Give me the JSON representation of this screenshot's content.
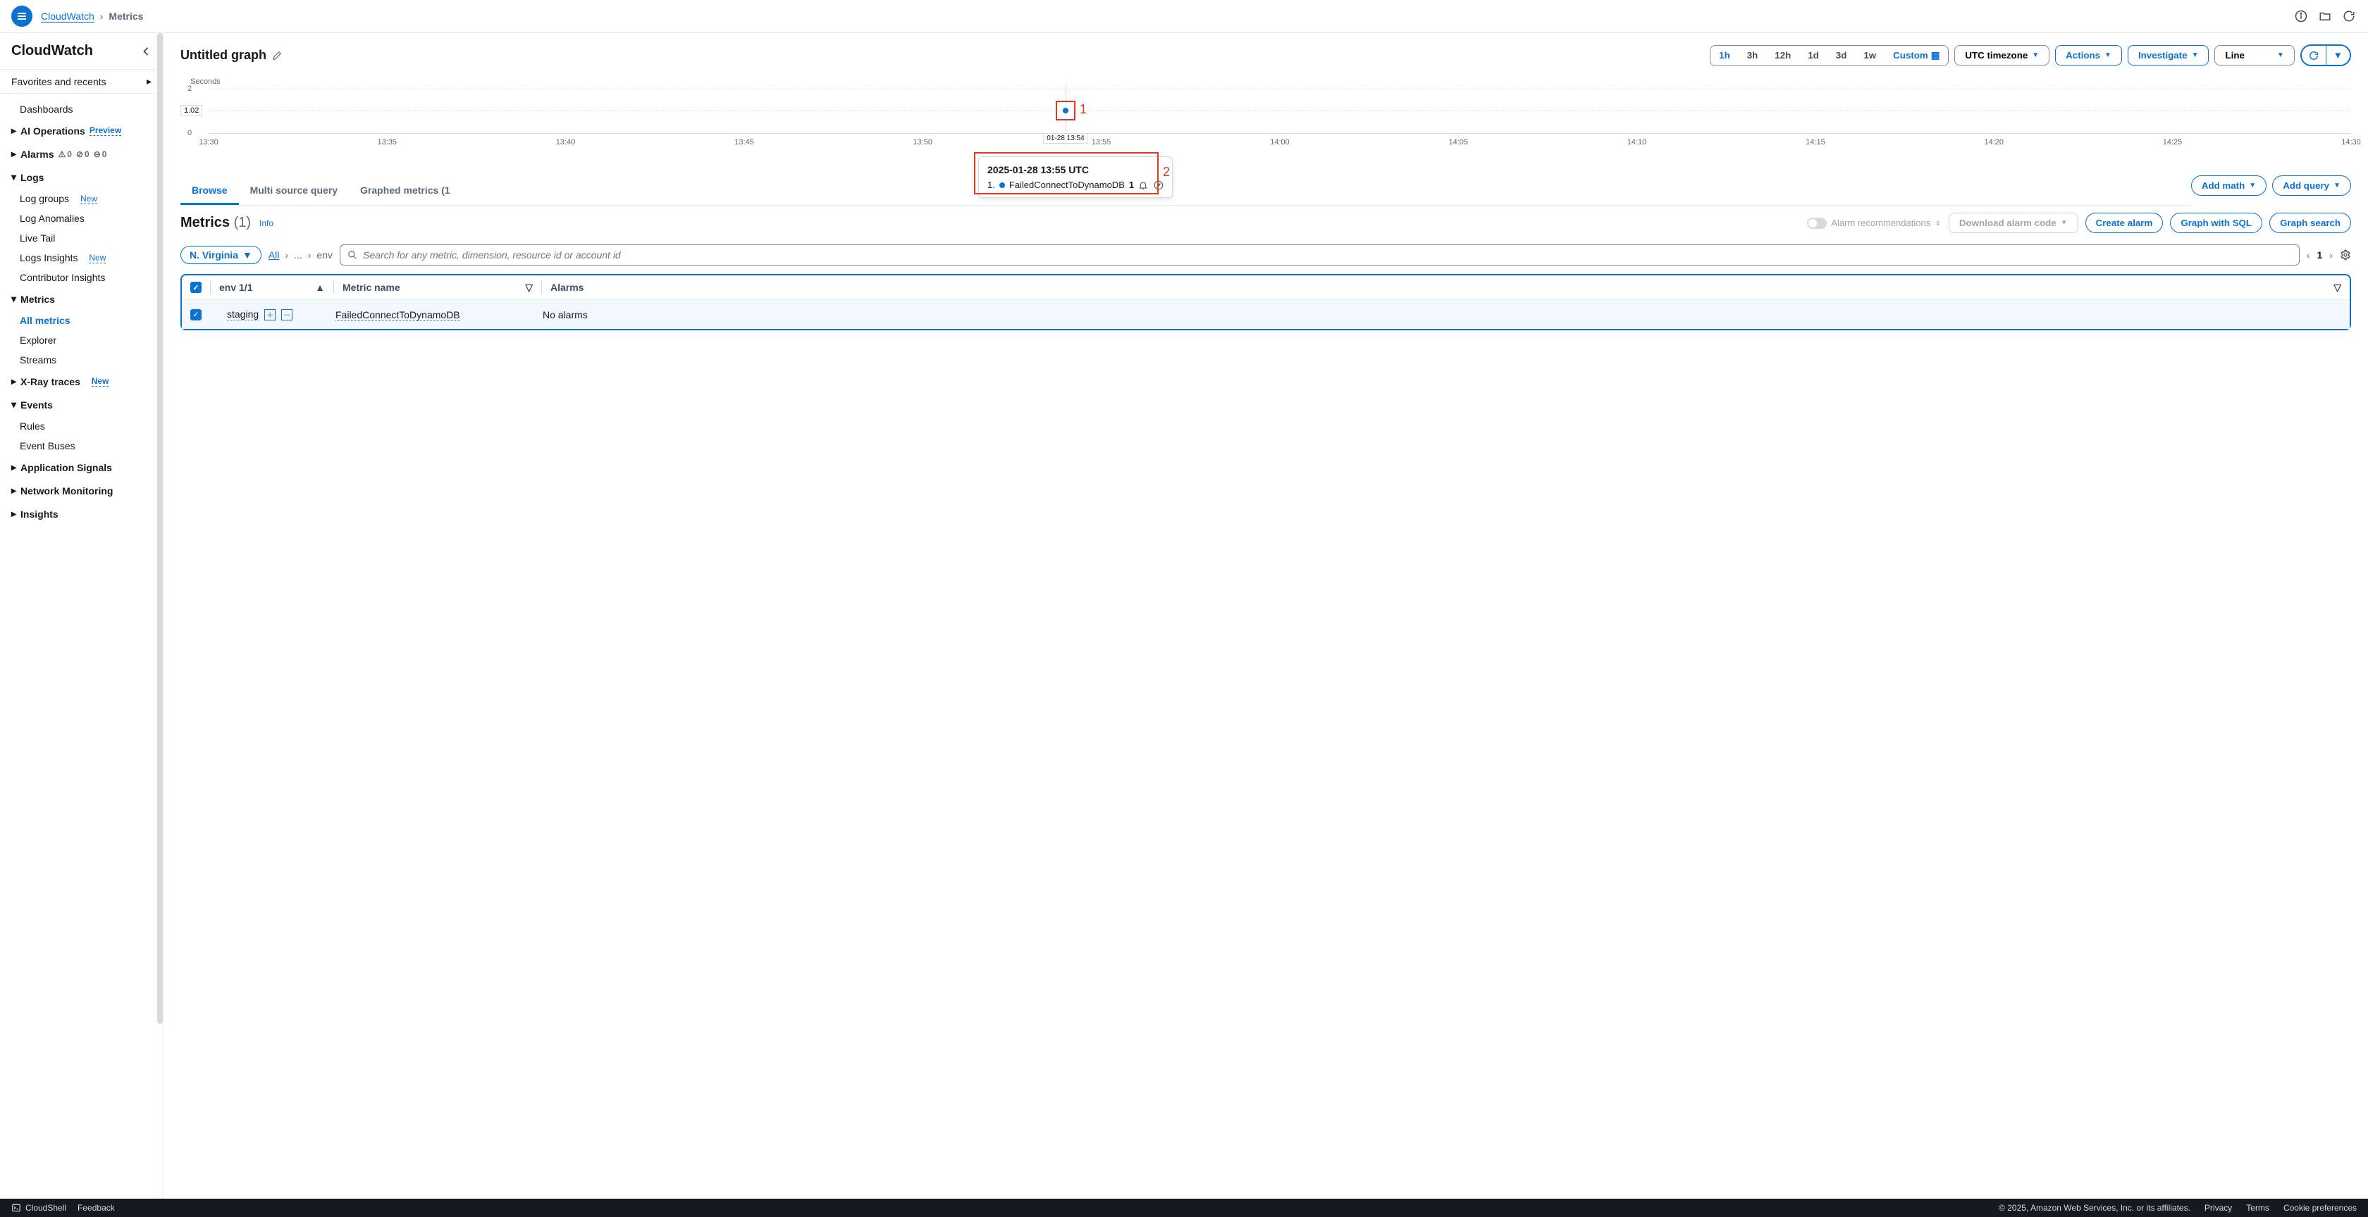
{
  "breadcrumb": {
    "root": "CloudWatch",
    "current": "Metrics"
  },
  "sidebar": {
    "title": "CloudWatch",
    "favorites": "Favorites and recents",
    "items": {
      "dashboards": "Dashboards",
      "aiops": "AI Operations",
      "aiops_badge": "Preview",
      "alarms": "Alarms",
      "logs": "Logs",
      "log_groups": "Log groups",
      "log_anomalies": "Log Anomalies",
      "live_tail": "Live Tail",
      "logs_insights": "Logs Insights",
      "contributor": "Contributor Insights",
      "metrics": "Metrics",
      "all_metrics": "All metrics",
      "explorer": "Explorer",
      "streams": "Streams",
      "xray": "X-Ray traces",
      "events": "Events",
      "rules": "Rules",
      "event_buses": "Event Buses",
      "app_signals": "Application Signals",
      "net_mon": "Network Monitoring",
      "insights": "Insights",
      "new": "New"
    },
    "alarm_counts": {
      "warn": "0",
      "ok": "0",
      "other": "0"
    }
  },
  "graph": {
    "title": "Untitled graph",
    "ranges": [
      "1h",
      "3h",
      "12h",
      "1d",
      "3d",
      "1w"
    ],
    "custom": "Custom",
    "timezone": "UTC timezone",
    "actions": "Actions",
    "investigate": "Investigate",
    "charttype": "Line"
  },
  "chart_data": {
    "type": "scatter",
    "ylabel": "Seconds",
    "yticks": [
      "0",
      "2"
    ],
    "highlight_y": "1.02",
    "xticks": [
      "13:30",
      "13:35",
      "13:40",
      "13:45",
      "13:50",
      "13:55",
      "14:00",
      "14:05",
      "14:10",
      "14:15",
      "14:20",
      "14:25",
      "14:30"
    ],
    "point_time_label": "01-28 13:54",
    "point_value": 1.02,
    "tooltip": {
      "title": "2025-01-28 13:55 UTC",
      "series_idx": "1.",
      "series_name": "FailedConnectToDynamoDB",
      "series_val": "1"
    },
    "annotations": {
      "a1": "1",
      "a2": "2"
    }
  },
  "tabs": {
    "browse": "Browse",
    "multi": "Multi source query",
    "graphed": "Graphed metrics (1"
  },
  "metrics_panel": {
    "heading": "Metrics",
    "count": "(1)",
    "info": "Info",
    "alarm_rec": "Alarm recommendations",
    "download": "Download alarm code",
    "create_alarm": "Create alarm",
    "graph_sql": "Graph with SQL",
    "graph_search": "Graph search",
    "add_math": "Add math",
    "add_query": "Add query",
    "region": "N. Virginia",
    "crumb_all": "All",
    "crumb_dots": "...",
    "crumb_env": "env",
    "search_placeholder": "Search for any metric, dimension, resource id or account id",
    "page": "1"
  },
  "table": {
    "col_env": "env 1/1",
    "col_metric": "Metric name",
    "col_alarms": "Alarms",
    "row": {
      "env": "staging",
      "metric": "FailedConnectToDynamoDB",
      "alarms": "No alarms"
    }
  },
  "footer": {
    "cloudshell": "CloudShell",
    "feedback": "Feedback",
    "copyright": "© 2025, Amazon Web Services, Inc. or its affiliates.",
    "privacy": "Privacy",
    "terms": "Terms",
    "cookie": "Cookie preferences"
  }
}
